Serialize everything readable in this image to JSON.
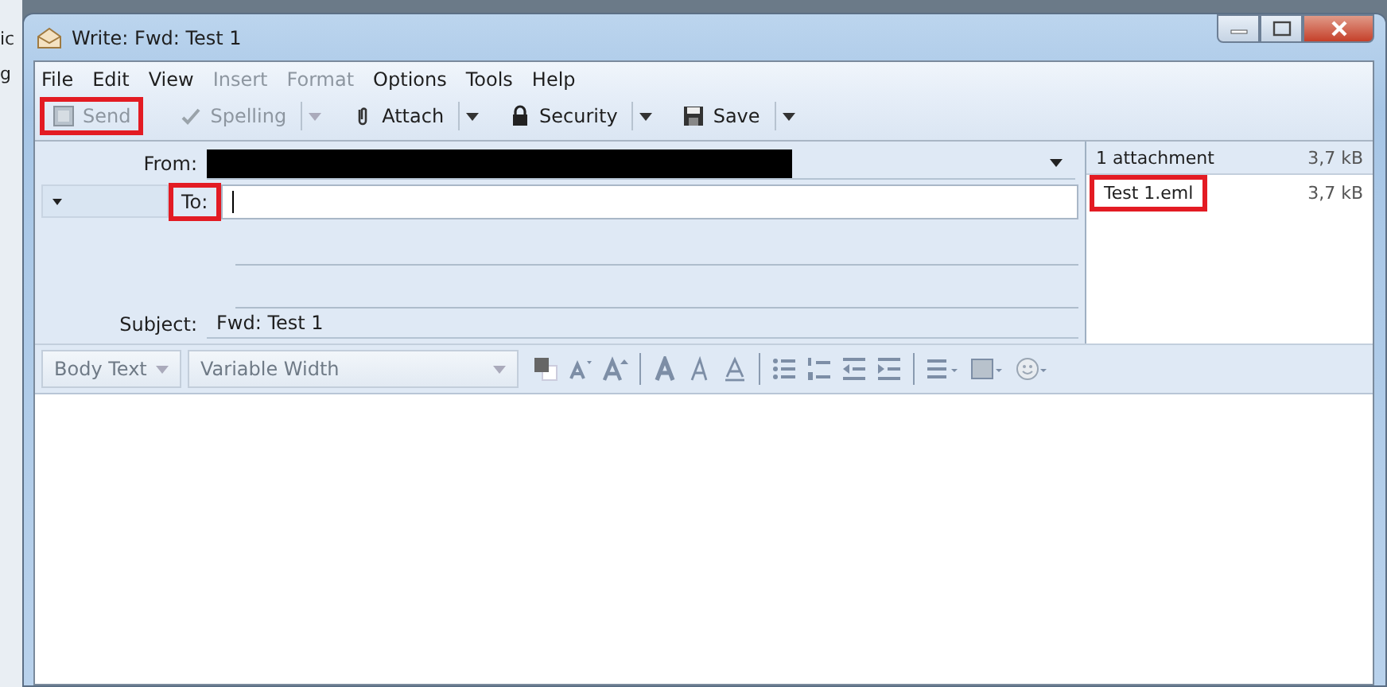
{
  "background_window": {
    "fragments": [
      "ic",
      "g"
    ]
  },
  "window": {
    "title": "Write: Fwd: Test 1"
  },
  "menu": [
    {
      "label": "File",
      "disabled": false
    },
    {
      "label": "Edit",
      "disabled": false
    },
    {
      "label": "View",
      "disabled": false
    },
    {
      "label": "Insert",
      "disabled": true
    },
    {
      "label": "Format",
      "disabled": true
    },
    {
      "label": "Options",
      "disabled": false
    },
    {
      "label": "Tools",
      "disabled": false
    },
    {
      "label": "Help",
      "disabled": false
    }
  ],
  "toolbar": [
    {
      "kind": "send",
      "label": "Send",
      "disabled": true,
      "highlighted": true,
      "dropdown": false
    },
    {
      "kind": "spelling",
      "label": "Spelling",
      "disabled": true,
      "highlighted": false,
      "dropdown": true
    },
    {
      "kind": "attach",
      "label": "Attach",
      "disabled": false,
      "highlighted": false,
      "dropdown": true
    },
    {
      "kind": "security",
      "label": "Security",
      "disabled": false,
      "highlighted": false,
      "dropdown": true
    },
    {
      "kind": "save",
      "label": "Save",
      "disabled": false,
      "highlighted": false,
      "dropdown": true
    }
  ],
  "header": {
    "from_label": "From:",
    "from_redacted": true,
    "to_label": "To:",
    "to_highlighted": true,
    "subject_label": "Subject:",
    "subject": "Fwd: Test 1"
  },
  "attachments": {
    "summary": "1 attachment",
    "total_size": "3,7 kB",
    "items": [
      {
        "name": "Test 1.eml",
        "size": "3,7 kB",
        "highlighted": true
      }
    ]
  },
  "format_bar": {
    "paragraph": "Body Text",
    "font": "Variable Width"
  }
}
